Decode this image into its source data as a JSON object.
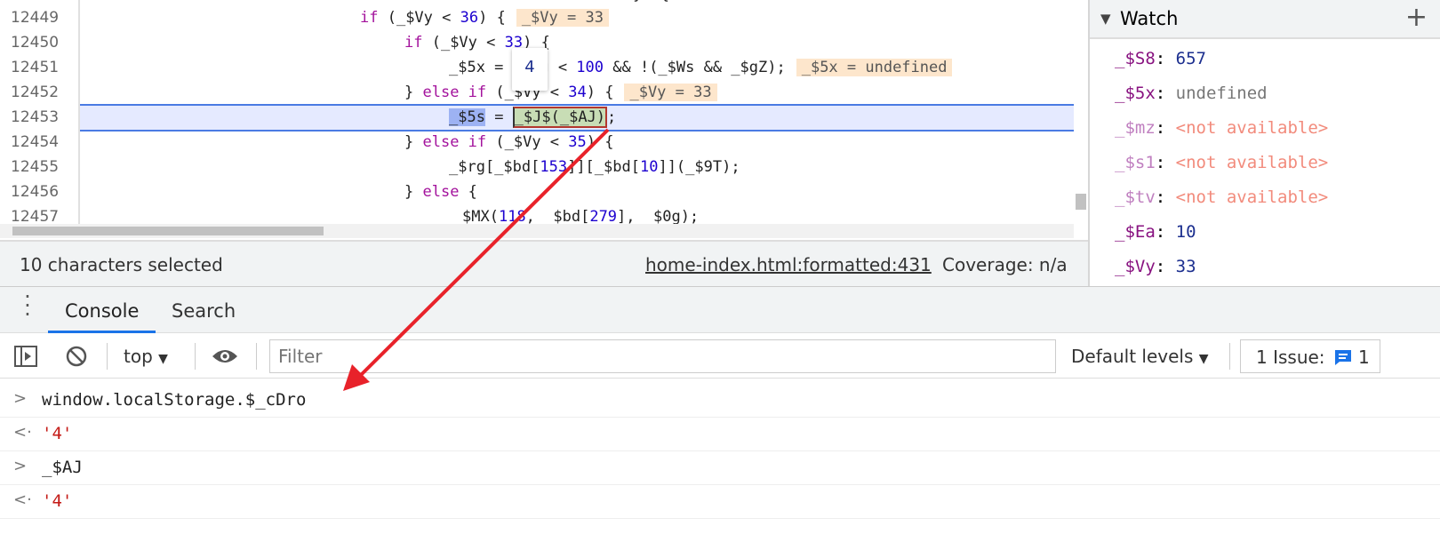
{
  "editor": {
    "lines": [
      {
        "n": "12449"
      },
      {
        "n": "12450"
      },
      {
        "n": "12451"
      },
      {
        "n": "12452"
      },
      {
        "n": "12453"
      },
      {
        "n": "12454"
      },
      {
        "n": "12455"
      },
      {
        "n": "12456"
      },
      {
        "n": "12457"
      }
    ],
    "inline_values": {
      "l12449": "_$Vy = 33",
      "l12451": "_$5x = undefined",
      "l12452": "_$Vy = 33"
    },
    "hover_popup": "4"
  },
  "status": {
    "selection": "10 characters selected",
    "source_link": "home-index.html:formatted:431",
    "coverage": "Coverage: n/a"
  },
  "watch": {
    "title": "Watch",
    "items": [
      {
        "key": "_$S8",
        "value": "657",
        "kind": "number"
      },
      {
        "key": "_$5x",
        "value": "undefined",
        "kind": "undefined"
      },
      {
        "key": "_$mz",
        "value": "<not available>",
        "kind": "na"
      },
      {
        "key": "_$s1",
        "value": "<not available>",
        "kind": "na"
      },
      {
        "key": "_$tv",
        "value": "<not available>",
        "kind": "na"
      },
      {
        "key": "_$Ea",
        "value": "10",
        "kind": "number"
      },
      {
        "key": "_$Vy",
        "value": "33",
        "kind": "number"
      }
    ]
  },
  "drawer": {
    "tabs": [
      "Console",
      "Search"
    ],
    "context": "top",
    "filter_placeholder": "Filter",
    "levels": "Default levels",
    "issues_label": "1 Issue:",
    "issues_count": "1"
  },
  "console": [
    {
      "type": "input",
      "text": "window.localStorage.$_cDro"
    },
    {
      "type": "output",
      "text": "'4'"
    },
    {
      "type": "input",
      "text": "_$AJ"
    },
    {
      "type": "output",
      "text": "'4'"
    }
  ],
  "colors": {
    "accent": "#1a73e8",
    "arrow": "#e8222a",
    "current_line": "#e5eaff"
  }
}
